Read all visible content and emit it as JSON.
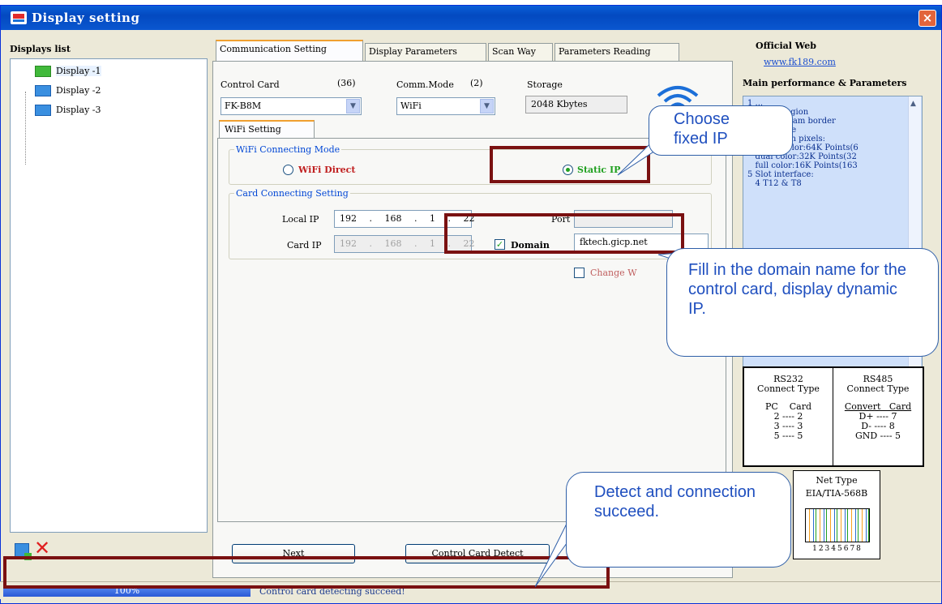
{
  "window": {
    "title": "Display setting",
    "close": "×"
  },
  "left": {
    "heading": "Displays list",
    "displays": [
      {
        "label": "Display -1",
        "selected": true
      },
      {
        "label": "Display -2",
        "selected": false
      },
      {
        "label": "Display -3",
        "selected": false
      }
    ],
    "delete_glyph": "✕"
  },
  "tabs": [
    "Communication Setting",
    "Display Parameters",
    "Scan Way",
    "Parameters Reading"
  ],
  "comm": {
    "control_card_label": "Control Card",
    "control_card_count": "(36)",
    "control_card_value": "FK-B8M",
    "comm_mode_label": "Comm.Mode",
    "comm_mode_count": "(2)",
    "comm_mode_value": "WiFi",
    "storage_label": "Storage",
    "storage_value": "2048 Kbytes",
    "wifi_tab": "WiFi Setting",
    "wifi_mode_legend": "WiFi Connecting Mode",
    "wifi_direct": "WiFi Direct",
    "static_ip": "Static IP",
    "card_conn_legend": "Card Connecting Setting",
    "local_ip_label": "Local IP",
    "local_ip_value": "192 . 168 . 1 . 22",
    "port_label": "Port",
    "card_ip_label": "Card IP",
    "card_ip_value": "192 . 168 . 1 . 22",
    "domain_label": "Domain",
    "domain_checked": true,
    "domain_value": "fktech.gicp.net",
    "change_label": "Change W",
    "change_checked": false,
    "btn_next": "Next",
    "btn_detect": "Control Card Detect"
  },
  "right": {
    "official_web": "Official Web",
    "web_link": "www.fk189.com",
    "perf_heading": "Main performance & Parameters",
    "perf_lines": [
      "1 ...",
      "2 Three region",
      "3 No program border",
      "3 No device",
      "4 Maximum pixels:",
      "   single color:64K Points(6",
      "   dual color:32K Points(32",
      "   full color:16K Points(163",
      "5 Slot interface:",
      "   4 T12 & T8"
    ],
    "rs232_title": "RS232\nConnect Type",
    "rs232_head": "PC    Card",
    "rs232_rows": [
      "2 ---- 2",
      "3 ---- 3",
      "5 ---- 5"
    ],
    "rs485_title": "RS485\nConnect Type",
    "rs485_head": "Convert   Card",
    "rs485_rows": [
      "D+ ---- 7",
      "D- ---- 8",
      "GND ---- 5"
    ],
    "net_title": "Net Type",
    "net_std": "EIA/TIA-568B",
    "net_pins": "12345678"
  },
  "status": {
    "progress_text": "100%",
    "progress": 1.0,
    "message": "Control card detecting succeed!"
  },
  "callouts": {
    "choose": "Choose fixed IP",
    "domain": "Fill in the domain name for the control card, display dynamic IP.",
    "detect": "Detect and connection succeed."
  },
  "colors": {
    "titlebar": "#0349c0",
    "highlight_frame": "#7a1111",
    "callout_text": "#1f4fbf",
    "progress": "#2a59d6"
  }
}
